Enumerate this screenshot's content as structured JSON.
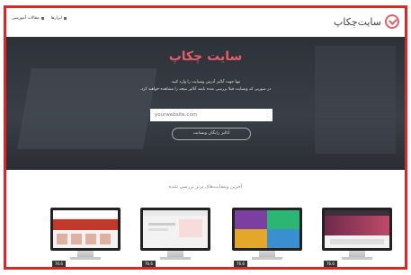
{
  "header": {
    "brand_name": "سایت‌چکاپ",
    "nav": [
      {
        "label": "ابزارها"
      },
      {
        "label": "مقالات آموزشی"
      }
    ]
  },
  "hero": {
    "title": "سایت چکاپ",
    "line1": "تنها جهت آنالیز آدرس وبسایت را وارد کنید.",
    "line2": "در صورتی که وبسایت قبلا بررسی شده باشد آنالیز نتیجه را مشاهده خواهید کرد.",
    "url_placeholder": "yourwebsite.com",
    "button_label": "آنالیز رایگان وبسایت"
  },
  "recent": {
    "title": "آخرین وبسایت‌های برتر بررسی شده",
    "cards": [
      {
        "rank": "76.6"
      },
      {
        "rank": "76.6"
      },
      {
        "rank": "76.6"
      },
      {
        "rank": "76.6"
      }
    ]
  },
  "colors": {
    "accent": "#e85d6c",
    "frame_border": "#d62a2a",
    "hero_bg": "#2d3138"
  },
  "icons": {
    "brand": "checkmark-circle-icon",
    "nav_marker": "square-bullet-icon"
  }
}
